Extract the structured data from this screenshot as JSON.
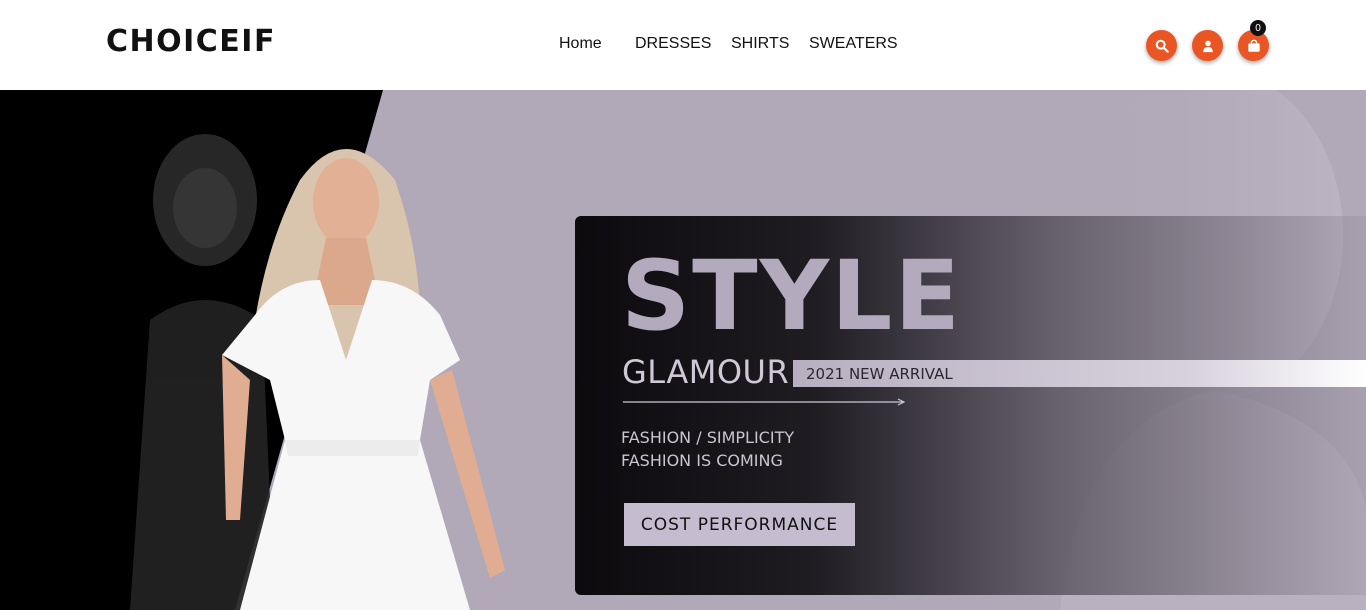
{
  "header": {
    "logo": "CHOICEIF",
    "nav": [
      {
        "label": "Home"
      },
      {
        "label": "DRESSES"
      },
      {
        "label": "SHIRTS"
      },
      {
        "label": "SWEATERS"
      }
    ],
    "icons": {
      "search": "search-icon",
      "account": "user-icon",
      "cart": "shopping-bag-icon"
    },
    "cart_count": "0"
  },
  "hero": {
    "headline": "STYLE",
    "subheadline": "GLAMOUR",
    "badge": "2021 NEW ARRIVAL",
    "tagline_1": "FASHION / SIMPLICITY",
    "tagline_2": "FASHION IS COMING",
    "cta": "COST PERFORMANCE"
  },
  "colors": {
    "accent": "#ea5524",
    "hero_background": "#b1a9b8",
    "headline": "#b3aabd"
  }
}
